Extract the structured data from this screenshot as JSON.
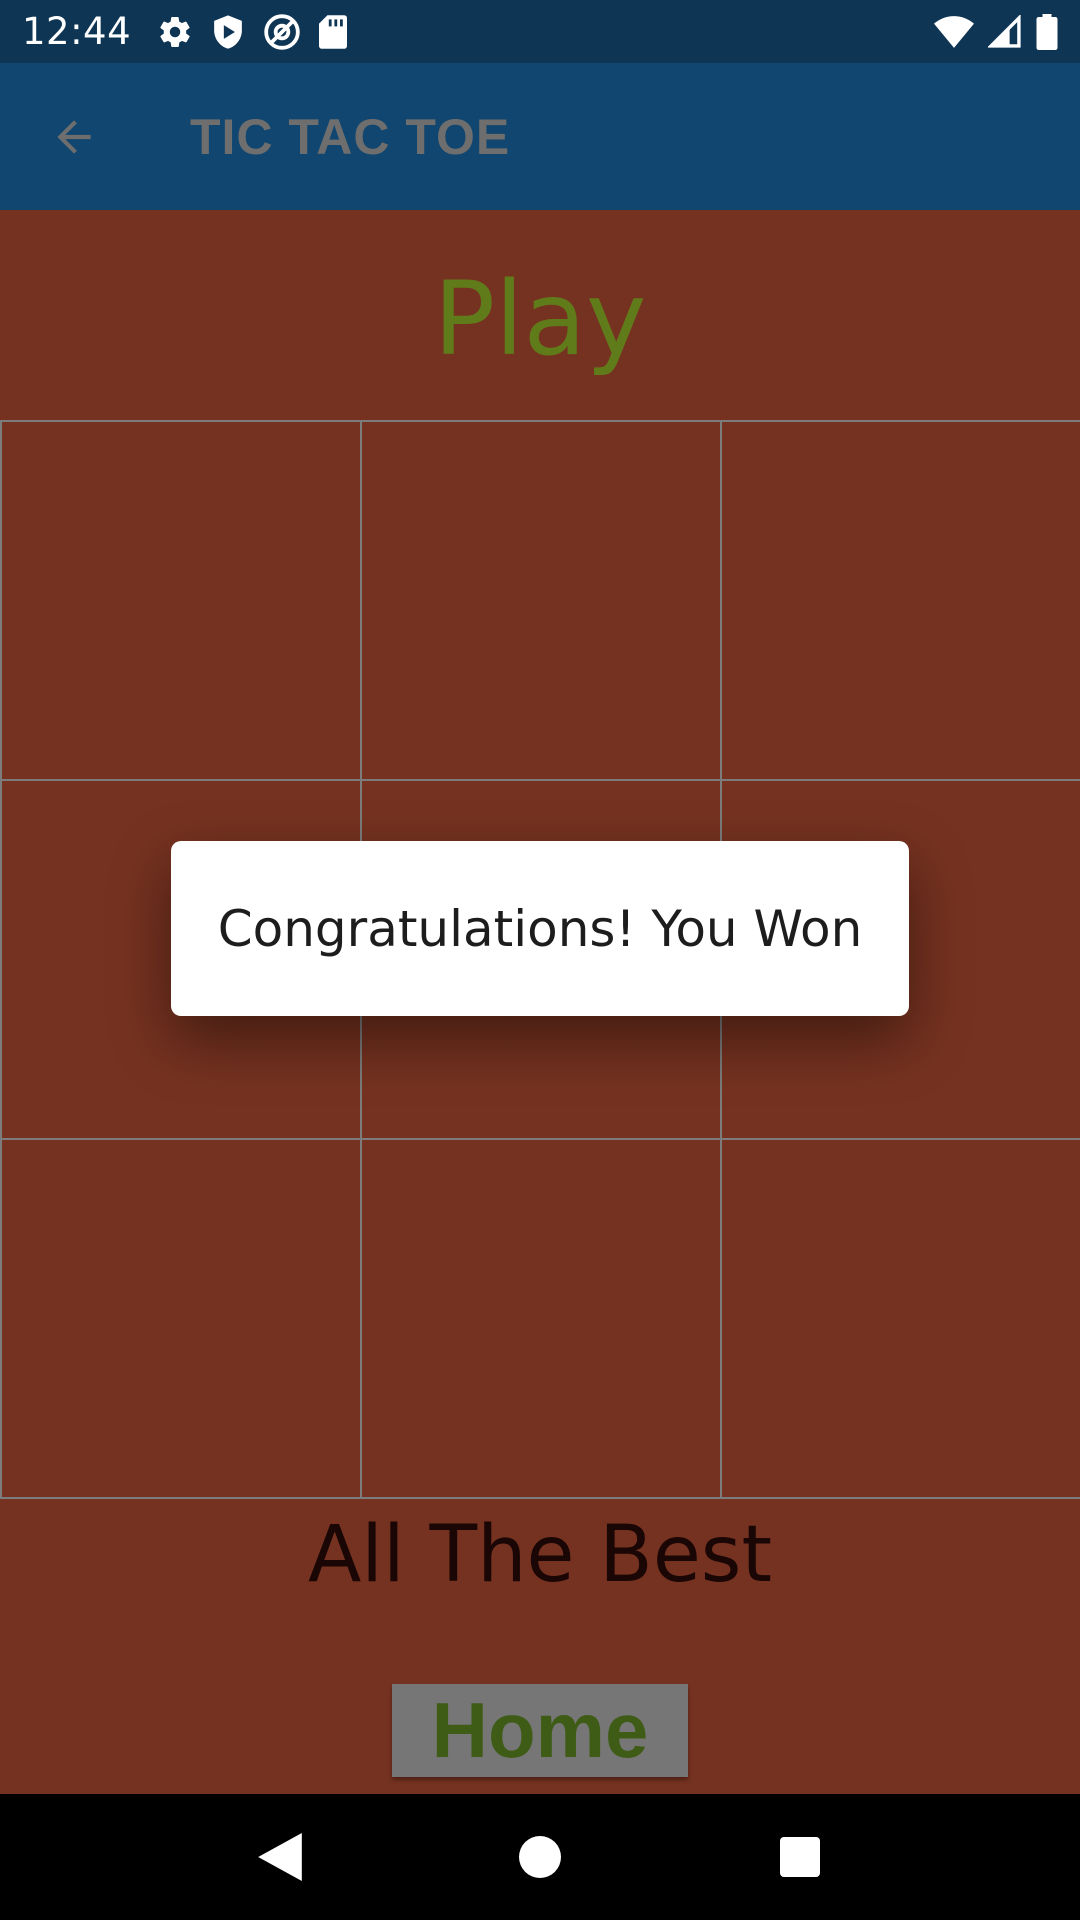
{
  "status_bar": {
    "time": "12:44",
    "icons_left": [
      "settings-icon",
      "shield-play-icon",
      "at-sign-icon",
      "sd-card-icon"
    ],
    "icons_right": [
      "wifi-icon",
      "cell-signal-icon",
      "battery-icon"
    ]
  },
  "app_bar": {
    "title": "TIC TAC TOE",
    "back_icon": "arrow-back-icon"
  },
  "game": {
    "heading": "Play",
    "board": [
      "",
      "",
      "",
      "",
      "",
      "",
      "",
      "",
      ""
    ],
    "tagline": "All The Best",
    "home_label": "Home"
  },
  "dialog": {
    "message": "Congratulations! You Won"
  },
  "nav_bar": {
    "buttons": [
      "back-triangle-icon",
      "home-circle-icon",
      "recents-square-icon"
    ]
  },
  "colors": {
    "status_bar": "#0e3554",
    "app_bar": "#10466f",
    "background": "#763220",
    "play_text": "#607c1a",
    "home_text": "#3f5c17",
    "home_bg": "#767676"
  }
}
